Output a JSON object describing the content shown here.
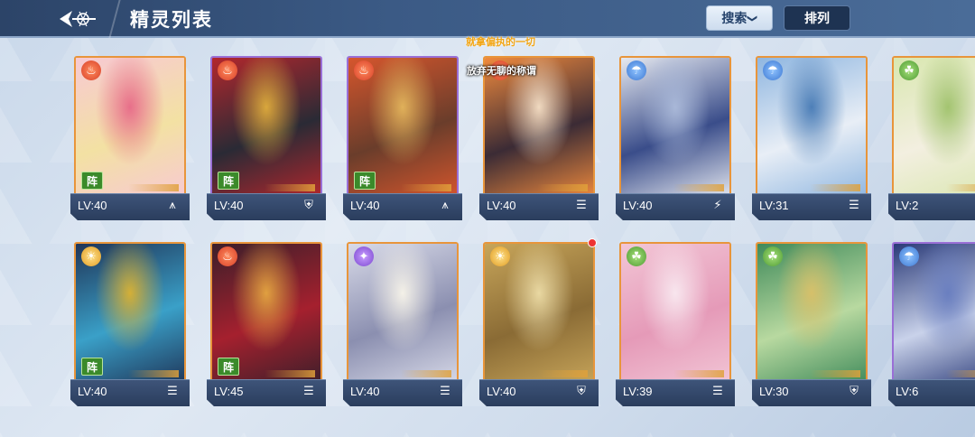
{
  "header": {
    "title": "精灵列表",
    "search_label": "搜索",
    "sort_label": "排列"
  },
  "floating": {
    "line1": "就拿偏执的一切",
    "line2": "放弃无聊的称谓"
  },
  "formation_label": "阵",
  "cards": [
    {
      "level": "LV:40",
      "element": "fire",
      "role_icon": "claw-icon",
      "formation": true,
      "frame": "orange",
      "art": [
        "#f7c9d3",
        "#f3e1a3",
        "#e86f8a"
      ]
    },
    {
      "level": "LV:40",
      "element": "fire",
      "role_icon": "shield-icon",
      "formation": true,
      "frame": "purple",
      "art": [
        "#b3272d",
        "#2a2a35",
        "#d9a73c"
      ]
    },
    {
      "level": "LV:40",
      "element": "fire",
      "role_icon": "claw-icon",
      "formation": true,
      "frame": "purple",
      "art": [
        "#d6562d",
        "#6a3d2b",
        "#e0b15a"
      ]
    },
    {
      "level": "LV:40",
      "element": "fire",
      "role_icon": "book-icon",
      "formation": false,
      "frame": "orange",
      "art": [
        "#f08a3d",
        "#3b2b35",
        "#f0d9c0"
      ]
    },
    {
      "level": "LV:40",
      "element": "water",
      "role_icon": "lightning-icon",
      "formation": false,
      "frame": "orange",
      "art": [
        "#e6e9f0",
        "#3a4d8a",
        "#a9b8d8"
      ]
    },
    {
      "level": "LV:31",
      "element": "water",
      "role_icon": "book-icon",
      "formation": false,
      "frame": "orange",
      "art": [
        "#8fb6e0",
        "#e8eef6",
        "#4d7fb8"
      ]
    },
    {
      "level": "LV:2",
      "element": "grass",
      "role_icon": "",
      "formation": false,
      "frame": "orange",
      "art": [
        "#d9e7b0",
        "#f3efe0",
        "#a3c470"
      ]
    },
    {
      "level": "LV:40",
      "element": "light",
      "role_icon": "book-icon",
      "formation": true,
      "frame": "orange",
      "art": [
        "#1f3558",
        "#3aa0c8",
        "#d4af37"
      ]
    },
    {
      "level": "LV:45",
      "element": "fire",
      "role_icon": "book-icon",
      "formation": true,
      "frame": "orange",
      "art": [
        "#3b1f2a",
        "#a5202e",
        "#e0a040"
      ]
    },
    {
      "level": "LV:40",
      "element": "dark",
      "role_icon": "book-icon",
      "formation": false,
      "frame": "orange",
      "art": [
        "#d8dae8",
        "#8b8fb0",
        "#f4f1e8"
      ]
    },
    {
      "level": "LV:40",
      "element": "light",
      "role_icon": "shield-icon",
      "formation": false,
      "frame": "orange",
      "art": [
        "#c7a55a",
        "#8a6b35",
        "#e9d8a2"
      ],
      "badge": true
    },
    {
      "level": "LV:39",
      "element": "grass",
      "role_icon": "book-icon",
      "formation": false,
      "frame": "orange",
      "art": [
        "#f2c6d6",
        "#e59ab8",
        "#f8e6ee"
      ]
    },
    {
      "level": "LV:30",
      "element": "grass",
      "role_icon": "shield-icon",
      "formation": false,
      "frame": "orange",
      "art": [
        "#3f8a5a",
        "#b8d9a0",
        "#d6c06a"
      ]
    },
    {
      "level": "LV:6",
      "element": "water",
      "role_icon": "",
      "formation": false,
      "frame": "purple",
      "art": [
        "#2a3a78",
        "#c9d2ea",
        "#6a7fc0"
      ]
    }
  ]
}
